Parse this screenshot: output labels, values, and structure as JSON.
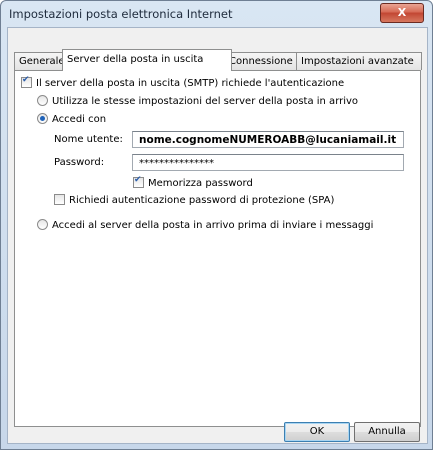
{
  "window": {
    "title": "Impostazioni posta elettronica Internet",
    "close_glyph": "X"
  },
  "tabs": [
    {
      "label": "Generale"
    },
    {
      "label": "Server della posta in uscita"
    },
    {
      "label": "Connessione"
    },
    {
      "label": "Impostazioni avanzate"
    }
  ],
  "outgoing": {
    "smtp_auth_label": "Il server della posta in uscita (SMTP) richiede l'autenticazione",
    "smtp_auth_checked": true,
    "use_same_label": "Utilizza le stesse impostazioni del server della posta in arrivo",
    "login_with_label": "Accedi con",
    "username_label": "Nome utente:",
    "username_value": "nome.cognomeNUMEROABB@lucaniamail.it",
    "password_label": "Password:",
    "password_value": "***************",
    "remember_password_label": "Memorizza password",
    "remember_password_checked": true,
    "spa_label": "Richiedi autenticazione password di protezione (SPA)",
    "spa_checked": false,
    "login_incoming_first_label": "Accedi al server della posta in arrivo prima di inviare i messaggi",
    "selected_option": "Accedi con"
  },
  "buttons": {
    "ok": "OK",
    "cancel": "Annulla"
  }
}
